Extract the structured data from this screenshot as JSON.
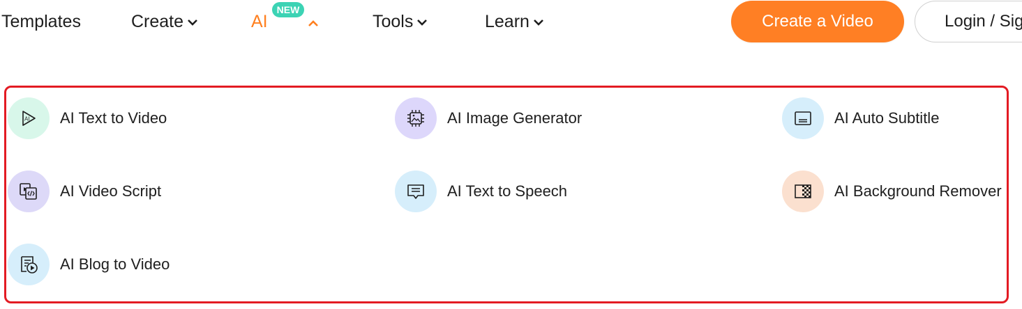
{
  "nav": {
    "templates": "Templates",
    "create": "Create",
    "ai": "AI",
    "ai_badge": "NEW",
    "tools": "Tools",
    "learn": "Learn",
    "create_video": "Create a Video",
    "login": "Login / Sign up"
  },
  "menu": {
    "items": [
      {
        "label": "AI Text to Video",
        "icon": "ai-play-icon",
        "color": "#d8f7ea"
      },
      {
        "label": "AI Image Generator",
        "icon": "chip-image-icon",
        "color": "#ddd7fb"
      },
      {
        "label": "AI Auto Subtitle",
        "icon": "subtitle-icon",
        "color": "#d6eefb"
      },
      {
        "label": "AI Video Script",
        "icon": "video-script-icon",
        "color": "#ddd9f8"
      },
      {
        "label": "AI Text to Speech",
        "icon": "speech-bubble-icon",
        "color": "#d6eefb"
      },
      {
        "label": "AI Background Remover",
        "icon": "checkerboard-icon",
        "color": "#fbe0cf"
      },
      {
        "label": "AI Blog to Video",
        "icon": "blog-play-icon",
        "color": "#d6eefb"
      }
    ]
  },
  "colors": {
    "accent": "#ff7f24",
    "badge": "#3cd3b4",
    "highlight_border": "#e31b23"
  }
}
